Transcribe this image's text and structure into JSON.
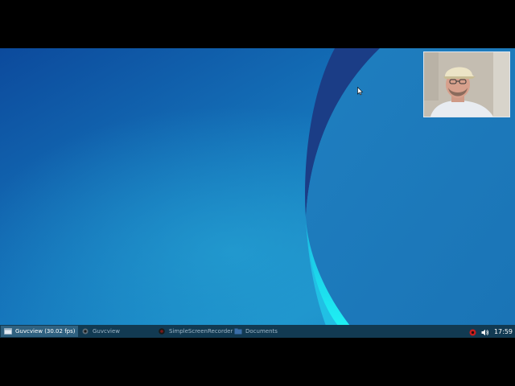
{
  "taskbar": {
    "tasks": [
      {
        "label": "Guvcview  (30.02 fps)",
        "active": true,
        "icon": "window-icon"
      },
      {
        "label": "Guvcview",
        "active": false,
        "icon": "webcam-icon"
      },
      {
        "label": "SimpleScreenRecorder",
        "active": false,
        "icon": "record-icon"
      },
      {
        "label": "Documents",
        "active": false,
        "icon": "folder-icon"
      }
    ]
  },
  "tray": {
    "icons": [
      "recording-indicator-icon",
      "volume-icon"
    ],
    "clock": "17:59"
  },
  "colors": {
    "taskbar_bg": "#123a52",
    "active_task_bg": "#2f6180",
    "wallpaper_primary": "#1368b3",
    "wallpaper_accent": "#1ee6f0"
  }
}
